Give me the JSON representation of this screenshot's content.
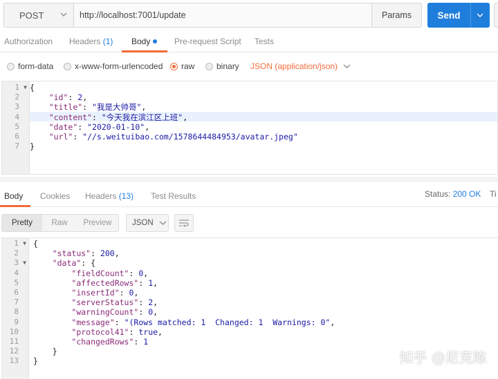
{
  "request": {
    "method": "POST",
    "url": "http://localhost:7001/update",
    "params_label": "Params",
    "send_label": "Send"
  },
  "request_tabs": [
    "Authorization",
    "Headers",
    "Body",
    "Pre-request Script",
    "Tests"
  ],
  "request_headers_count": "(1)",
  "body_types": [
    "form-data",
    "x-www-form-urlencoded",
    "raw",
    "binary"
  ],
  "selected_body_type": "raw",
  "content_type": "JSON (application/json)",
  "request_body_lines": [
    "{",
    "    \"id\": 2,",
    "    \"title\": \"我是大帅哥\",",
    "    \"content\": \"今天我在滨江区上班\",",
    "    \"date\": \"2020-01-10\",",
    "    \"url\": \"//s.weituibao.com/1578644484953/avatar.jpeg\"",
    "}"
  ],
  "response_tabs": [
    "Body",
    "Cookies",
    "Headers",
    "Test Results"
  ],
  "response_headers_count": "(13)",
  "status_label": "Status:",
  "status_value": "200 OK",
  "time_label_cut": "Ti",
  "view_modes": [
    "Pretty",
    "Raw",
    "Preview"
  ],
  "format": "JSON",
  "response_body_lines": [
    "{",
    "    \"status\": 200,",
    "    \"data\": {",
    "        \"fieldCount\": 0,",
    "        \"affectedRows\": 1,",
    "        \"insertId\": 0,",
    "        \"serverStatus\": 2,",
    "        \"warningCount\": 0,",
    "        \"message\": \"(Rows matched: 1  Changed: 1  Warnings: 0\",",
    "        \"protocol41\": true,",
    "        \"changedRows\": 1",
    "    }",
    "}"
  ],
  "watermark": "知乎 @尼克陈",
  "colors": {
    "accent_blue": "#1f7ddc",
    "accent_orange": "#f26b3a"
  }
}
